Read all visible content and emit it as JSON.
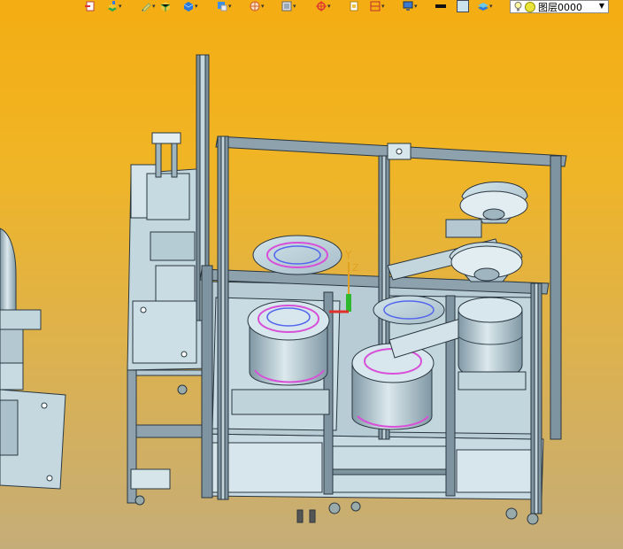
{
  "toolbar": {
    "buttons": [
      {
        "icon": "exit-layer-icon",
        "dropdown": false
      },
      {
        "icon": "layer-stack-icon",
        "dropdown": true
      },
      {
        "icon": "pencil-icon",
        "dropdown": true
      },
      {
        "icon": "color-box-icon",
        "dropdown": false
      },
      {
        "icon": "blue-cube-icon",
        "dropdown": true
      },
      {
        "icon": "cube-view-icon",
        "dropdown": true
      },
      {
        "icon": "render-sphere-icon",
        "dropdown": true
      },
      {
        "icon": "frame-view-icon",
        "dropdown": true
      },
      {
        "icon": "snap-target-icon",
        "dropdown": true
      },
      {
        "icon": "page-icon",
        "dropdown": false
      },
      {
        "icon": "align-icon",
        "dropdown": true
      },
      {
        "icon": "monitor-icon",
        "dropdown": true
      },
      {
        "icon": "line-style-icon",
        "dropdown": false
      },
      {
        "icon": "color-swatch-icon",
        "dropdown": false
      },
      {
        "icon": "layers-icon",
        "dropdown": true
      }
    ],
    "layer_select": {
      "value": "图层0000"
    }
  },
  "colors": {
    "frame": "#8a9aa6",
    "frame_dark": "#3a4a55",
    "metal": "#b9cfd9",
    "panel": "#c8dbe3",
    "accent_magenta": "#d84fd8",
    "accent_blue": "#5566ee",
    "axis_red": "#e0302a",
    "axis_green": "#2eb82e"
  }
}
